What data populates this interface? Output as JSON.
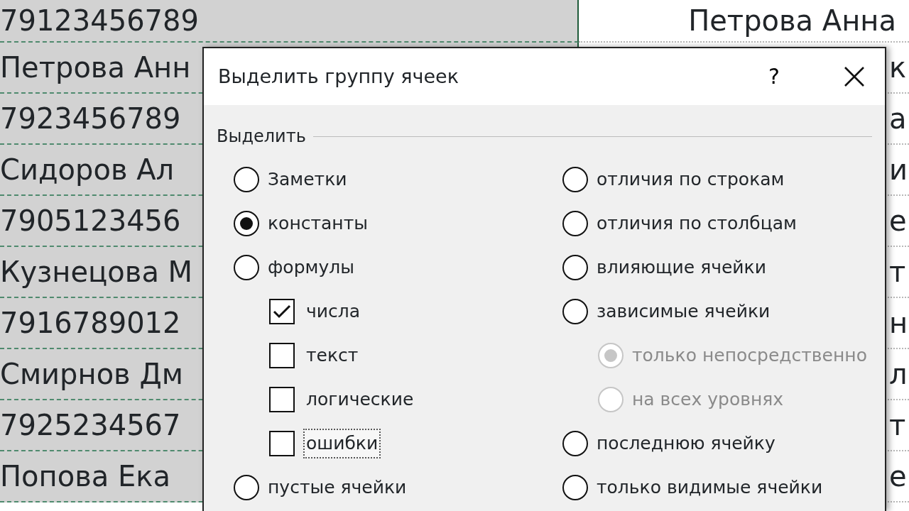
{
  "sheet": {
    "rows": [
      {
        "cell_1": "79123456789",
        "cell_2": "Петрова Анна"
      },
      {
        "cell_1": "Петрова Анн",
        "cell_2": "к"
      },
      {
        "cell_1": "7923456789",
        "cell_2": "а"
      },
      {
        "cell_1": "Сидоров Ал",
        "cell_2": "и"
      },
      {
        "cell_1": "7905123456",
        "cell_2": "е"
      },
      {
        "cell_1": "Кузнецова М",
        "cell_2": "т"
      },
      {
        "cell_1": "7916789012",
        "cell_2": "н"
      },
      {
        "cell_1": "Смирнов Дм",
        "cell_2": "л"
      },
      {
        "cell_1": "7925234567",
        "cell_2": "т"
      },
      {
        "cell_1": "Попова Ека",
        "cell_2": "е"
      }
    ]
  },
  "dialog": {
    "title": "Выделить группу ячеек",
    "help": "?",
    "group_label": "Выделить",
    "options_left": [
      {
        "kind": "radio",
        "label": "Заметки",
        "selected": false
      },
      {
        "kind": "radio",
        "label": "константы",
        "selected": true
      },
      {
        "kind": "radio",
        "label": "формулы",
        "selected": false,
        "children": [
          {
            "kind": "checkbox",
            "label": "числа",
            "checked": true,
            "focused": false
          },
          {
            "kind": "checkbox",
            "label": "текст",
            "checked": false,
            "focused": false
          },
          {
            "kind": "checkbox",
            "label": "логические",
            "checked": false,
            "focused": false
          },
          {
            "kind": "checkbox",
            "label": "ошибки",
            "checked": false,
            "focused": true
          }
        ]
      },
      {
        "kind": "radio",
        "label": "пустые ячейки",
        "selected": false
      }
    ],
    "options_right": [
      {
        "kind": "radio",
        "label": "отличия по строкам",
        "selected": false
      },
      {
        "kind": "radio",
        "label": "отличия по столбцам",
        "selected": false
      },
      {
        "kind": "radio",
        "label": "влияющие ячейки",
        "selected": false
      },
      {
        "kind": "radio",
        "label": "зависимые ячейки",
        "selected": false,
        "children": [
          {
            "kind": "radio",
            "label": "только непосредственно",
            "selected": true,
            "disabled": true
          },
          {
            "kind": "radio",
            "label": "на всех уровнях",
            "selected": false,
            "disabled": true
          }
        ]
      },
      {
        "kind": "radio",
        "label": "последнюю ячейку",
        "selected": false
      },
      {
        "kind": "radio",
        "label": "только видимые ячейки",
        "selected": false
      }
    ]
  }
}
